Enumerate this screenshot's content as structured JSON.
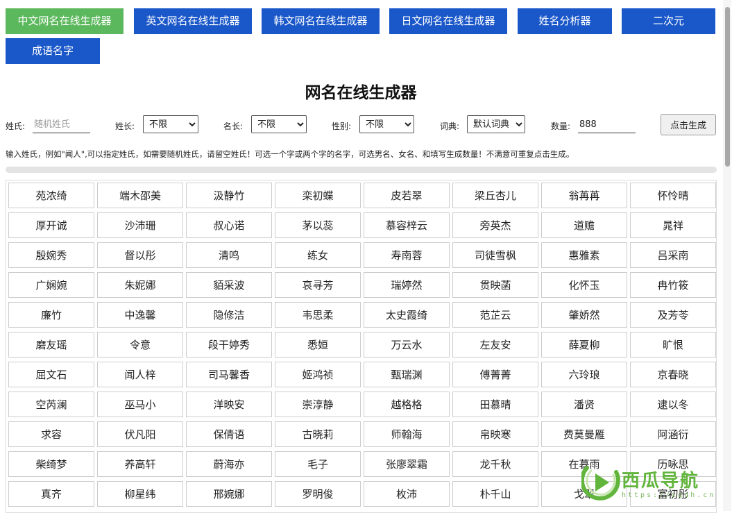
{
  "tabs": [
    {
      "label": "中文网名在线生成器",
      "active": true
    },
    {
      "label": "英文网名在线生成器",
      "active": false
    },
    {
      "label": "韩文网名在线生成器",
      "active": false
    },
    {
      "label": "日文网名在线生成器",
      "active": false
    },
    {
      "label": "姓名分析器",
      "active": false
    },
    {
      "label": "二次元",
      "active": false
    },
    {
      "label": "成语名字",
      "active": false
    }
  ],
  "title": "网名在线生成器",
  "form": {
    "surname_label": "姓氏:",
    "surname_placeholder": "随机姓氏",
    "surname_length_label": "姓长:",
    "surname_length_value": "不限",
    "name_length_label": "名长:",
    "name_length_value": "不限",
    "gender_label": "性别:",
    "gender_value": "不限",
    "dictionary_label": "词典:",
    "dictionary_value": "默认词典",
    "count_label": "数量:",
    "count_value": "888",
    "generate_label": "点击生成"
  },
  "hint": "输入姓氏，例如\"闻人\",可以指定姓氏，如需要随机姓氏，请留空姓氏！可选一个字或两个字的名字，可选男名、女名、和填写生成数量！不满意可重复点击生成。",
  "progress": 1.0,
  "names": [
    "苑浓绮",
    "端木邵美",
    "汲静竹",
    "栾初蝶",
    "皮若翠",
    "梁丘杏儿",
    "翁苒苒",
    "怀怜晴",
    "厚开诚",
    "沙沛珊",
    "叔心诺",
    "茅以蕊",
    "慕容梓云",
    "旁英杰",
    "道赡",
    "晁祥",
    "殷婉秀",
    "督以彤",
    "清鸣",
    "练女",
    "寿南蓉",
    "司徒雪枫",
    "惠雅素",
    "吕采南",
    "广娴婉",
    "朱妮娜",
    "貊采波",
    "哀寻芳",
    "瑞婷然",
    "贯映菡",
    "化怀玉",
    "冉竹筱",
    "廉竹",
    "中逸馨",
    "隐修洁",
    "韦思柔",
    "太史霞绮",
    "范芷云",
    "肇娇然",
    "及芳苓",
    "磨友瑶",
    "令意",
    "段干婷秀",
    "悉姮",
    "万云水",
    "左友安",
    "薛夏柳",
    "旷恨",
    "屈文石",
    "闻人梓",
    "司马馨香",
    "姬鸿祯",
    "甄瑞渊",
    "傅菁菁",
    "六玲琅",
    "京春晓",
    "空芮澜",
    "巫马小",
    "洋映安",
    "崇淳静",
    "越格格",
    "田慕晴",
    "潘贤",
    "逮以冬",
    "求容",
    "伏凡阳",
    "保倩语",
    "古晓莉",
    "师翰海",
    "帛映寒",
    "费莫曼雁",
    "阿涵衍",
    "柴绮梦",
    "养高轩",
    "蔚海亦",
    "毛子",
    "张廖翠霜",
    "龙千秋",
    "在暮雨",
    "历咏思",
    "真齐",
    "柳星纬",
    "邢婉娜",
    "罗明俊",
    "枚沛",
    "朴千山",
    "戈翠",
    "富初彤"
  ],
  "watermark": {
    "title": "西瓜导航",
    "url": "https://xgdh.cn",
    "logo_icon": "watermelon-play-icon"
  },
  "colors": {
    "tab_active": "#5cb85c",
    "tab_default": "#1a57c9",
    "watermark_green": "#62b53c"
  }
}
